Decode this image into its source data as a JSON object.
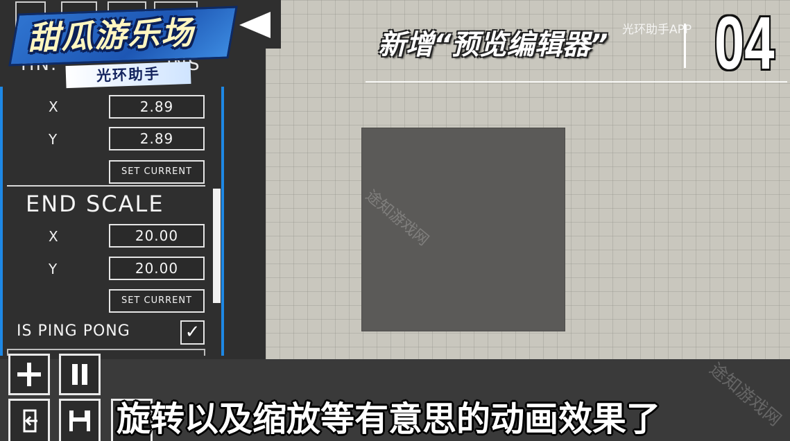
{
  "logo": {
    "title": "甜瓜游乐场",
    "badge": "光环助手"
  },
  "panel": {
    "partial_heading_left": "HN.",
    "partial_heading_right": "INS",
    "start": {
      "x_label": "X",
      "x_value": "2.89",
      "y_label": "Y",
      "y_value": "2.89",
      "set_current": "SET CURRENT"
    },
    "end": {
      "heading": "END SCALE",
      "x_label": "X",
      "x_value": "20.00",
      "y_label": "Y",
      "y_value": "20.00",
      "set_current": "SET CURRENT"
    },
    "ping_pong": {
      "label": "IS PING PONG",
      "checked": true,
      "check_glyph": "✓"
    }
  },
  "toolbar": {
    "icons": [
      "back-arrow-icon",
      "plus-icon",
      "pause-icon",
      "exit-icon",
      "save-icon"
    ]
  },
  "overlay": {
    "title": "新增“预览编辑器”",
    "episode": "04",
    "channel": "光环助手APP"
  },
  "subtitle": "旋转以及缩放等有意思的动画效果了",
  "watermarks": [
    "途知游戏网",
    "途知游戏网"
  ],
  "colors": {
    "accent": "#1e88e5",
    "panel": "#2f2f2f",
    "grid": "#c9c7be",
    "shape": "#5b5a58",
    "logo_blue": "#1d56b3"
  }
}
